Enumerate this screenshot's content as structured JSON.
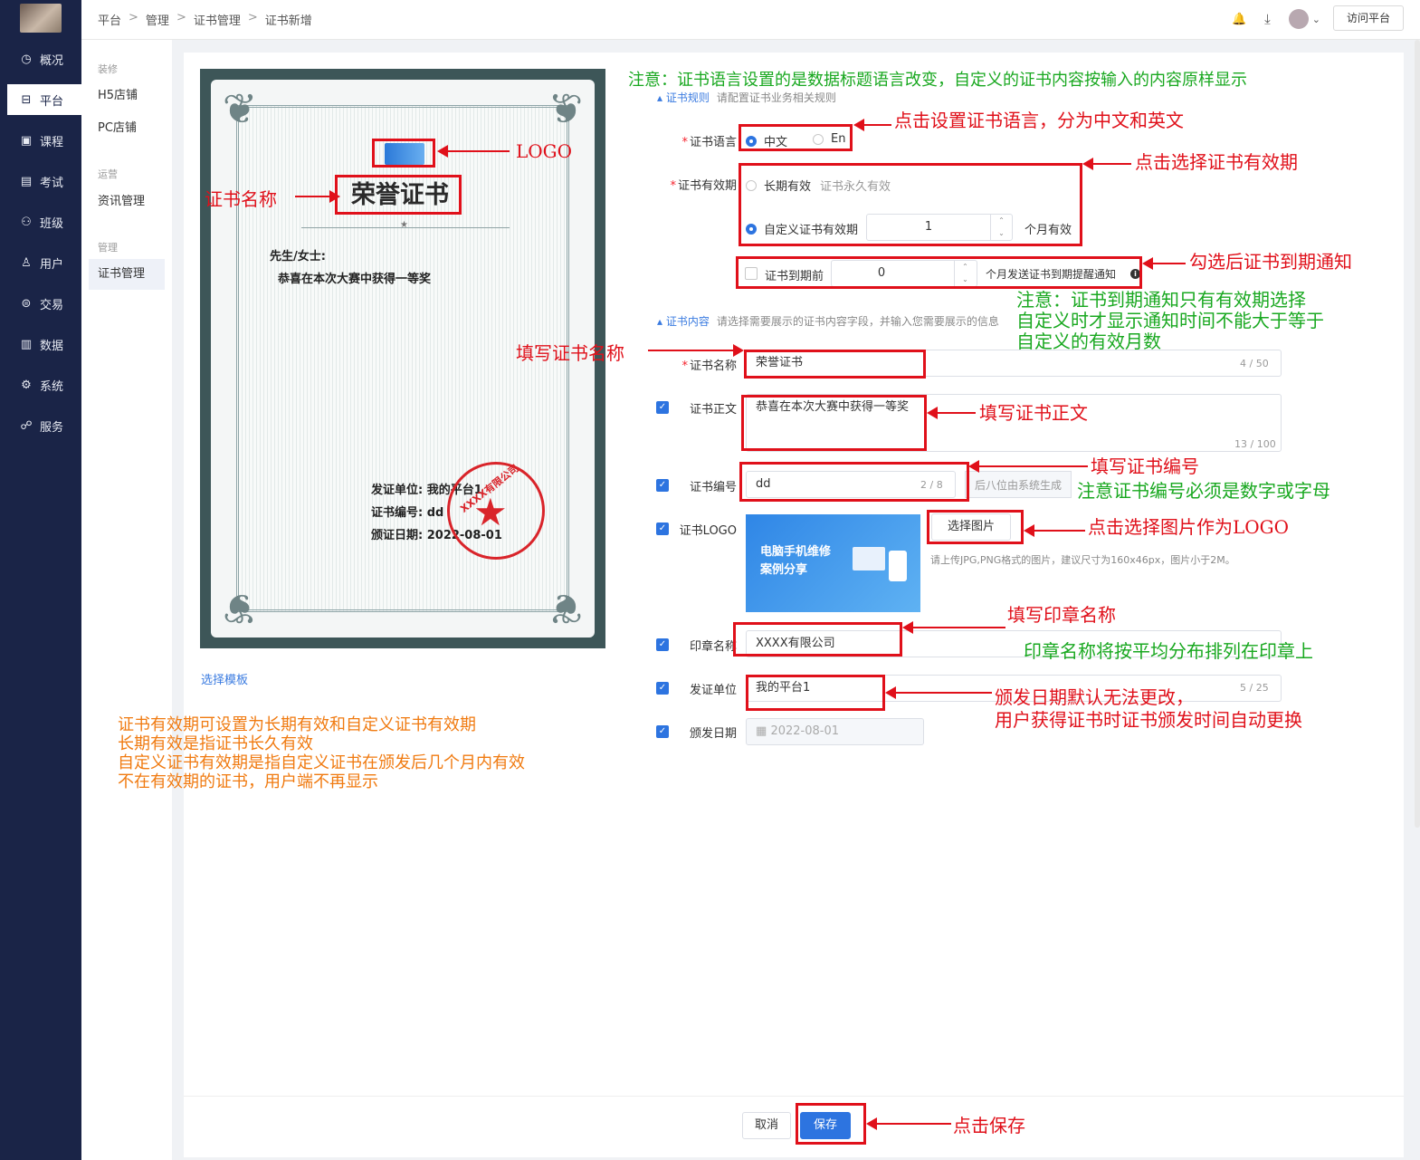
{
  "nav": {
    "items": [
      {
        "icon": "dashboard-icon",
        "glyph": "◷",
        "label": "概况"
      },
      {
        "icon": "store-icon",
        "glyph": "⊟",
        "label": "平台"
      },
      {
        "icon": "course-icon",
        "glyph": "▣",
        "label": "课程"
      },
      {
        "icon": "exam-icon",
        "glyph": "▤",
        "label": "考试"
      },
      {
        "icon": "class-icon",
        "glyph": "⚇",
        "label": "班级"
      },
      {
        "icon": "user-icon",
        "glyph": "♙",
        "label": "用户"
      },
      {
        "icon": "trade-icon",
        "glyph": "⊜",
        "label": "交易"
      },
      {
        "icon": "data-icon",
        "glyph": "▥",
        "label": "数据"
      },
      {
        "icon": "system-icon",
        "glyph": "⚙",
        "label": "系统"
      },
      {
        "icon": "service-icon",
        "glyph": "☍",
        "label": "服务"
      }
    ]
  },
  "subnav": {
    "groups": [
      {
        "title": "装修",
        "items": [
          "H5店铺",
          "PC店铺"
        ]
      },
      {
        "title": "运营",
        "items": [
          "资讯管理"
        ]
      },
      {
        "title": "管理",
        "items": [
          "证书管理"
        ]
      }
    ]
  },
  "header": {
    "breadcrumb": [
      "平台",
      "管理",
      "证书管理",
      "证书新增"
    ],
    "sep": ">",
    "bell": "🔔",
    "download": "⤓",
    "caret": "⌄",
    "visit_label": "访问平台"
  },
  "certificate": {
    "title": "荣誉证书",
    "star": "★",
    "ornament": "❦",
    "recipient": "先生/女士:",
    "body": "恭喜在本次大赛中获得一等奖",
    "issuer_line": "发证单位:  我的平台1",
    "number_line": "证书编号:  dd",
    "date_line": "颁证日期:  2022-08-01",
    "seal_text": "XXXX有限公司",
    "choose_template": "选择模板"
  },
  "form": {
    "rules_section": {
      "title": "证书规则",
      "hint": "请配置证书业务相关规则"
    },
    "content_section": {
      "title": "证书内容",
      "hint": "请选择需要展示的证书内容字段，并输入您需要展示的信息"
    },
    "language": {
      "label": "证书语言",
      "options": [
        "中文",
        "En"
      ]
    },
    "validity": {
      "label": "证书有效期",
      "long_term": "长期有效",
      "long_term_hint": "证书永久有效",
      "custom": "自定义证书有效期",
      "months": "1",
      "months_suffix": "个月有效"
    },
    "expiry_notice": {
      "label": "证书到期前",
      "value": "0",
      "suffix": "个月发送证书到期提醒通知",
      "info": "i"
    },
    "name": {
      "label": "证书名称",
      "value": "荣誉证书",
      "count": "4 / 50"
    },
    "body": {
      "label": "证书正文",
      "value": "恭喜在本次大赛中获得一等奖",
      "count": "13 / 100"
    },
    "number": {
      "label": "证书编号",
      "value": "dd",
      "count": "2 / 8",
      "suffix": "后八位由系统生成"
    },
    "logo": {
      "label": "证书LOGO",
      "button": "选择图片",
      "hint": "请上传JPG,PNG格式的图片，建议尺寸为160x46px，图片小于2M。",
      "image_text_1": "电脑手机维修",
      "image_text_2": "案例分享"
    },
    "seal": {
      "label": "印章名称",
      "value": "XXXX有限公司"
    },
    "issuer": {
      "label": "发证单位",
      "value": "我的平台1",
      "count": "5 / 25"
    },
    "date": {
      "label": "颁发日期",
      "value": "2022-08-01",
      "icon": "▦"
    },
    "check": "✓",
    "up": "⌃",
    "down": "⌄",
    "cancel": "取消",
    "save": "保存"
  },
  "annotations": {
    "top_note": "注意：证书语言设置的是数据标题语言改变，自定义的证书内容按输入的内容原样显示",
    "logo": "LOGO",
    "cert_name": "证书名称",
    "language": "点击设置证书语言，分为中文和英文",
    "validity": "点击选择证书有效期",
    "notice": "勾选后证书到期通知",
    "notice_note": "注意：证书到期通知只有有效期选择\n自定义时才显示通知时间不能大于等于\n自定义的有效月数",
    "fill_name": "填写证书名称",
    "fill_body": "填写证书正文",
    "fill_number": "填写证书编号",
    "number_note": "注意证书编号必须是数字或字母",
    "pick_logo": "点击选择图片作为LOGO",
    "fill_seal": "填写印章名称",
    "seal_note": "印章名称将按平均分布排列在印章上",
    "date_note": "颁发日期默认无法更改，\n用户获得证书时证书颁发时间自动更换",
    "validity_note": "证书有效期可设置为长期有效和自定义证书有效期\n长期有效是指证书长久有效\n自定义证书有效期是指自定义证书在颁发后几个月内有效\n不在有效期的证书，用户端不再显示",
    "save": "点击保存"
  }
}
